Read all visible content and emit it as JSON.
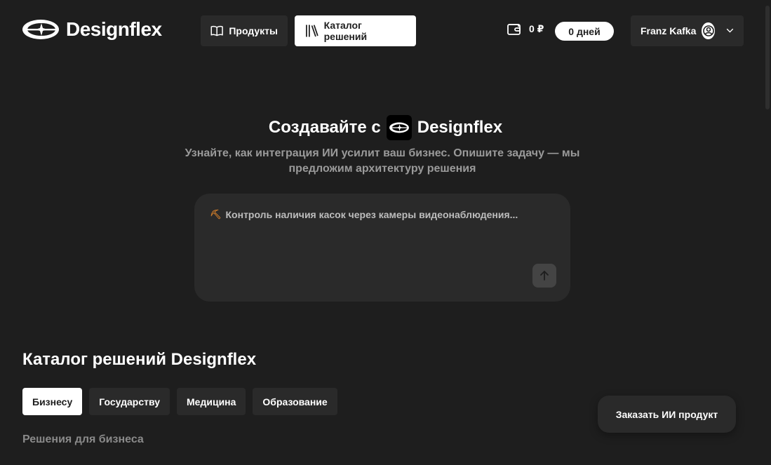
{
  "header": {
    "brand": "Designflex",
    "nav": {
      "products_label": "Продукты",
      "catalog_label": "Каталог решений"
    },
    "wallet_amount": "0 ₽",
    "days_label": "0 дней",
    "user_name": "Franz Kafka"
  },
  "hero": {
    "title_prefix": "Создавайте с",
    "title_brand": "Designflex",
    "subtitle": "Узнайте, как интеграция ИИ усилит ваш бизнес. Опишите задачу — мы предложим архитектуру решения",
    "prompt_emoji": "⛏",
    "prompt_placeholder": "Контроль наличия касок через камеры видеонаблюдения..."
  },
  "catalog": {
    "title": "Каталог решений Designflex",
    "tabs": [
      {
        "label": "Бизнесу",
        "active": true
      },
      {
        "label": "Государству",
        "active": false
      },
      {
        "label": "Медицина",
        "active": false
      },
      {
        "label": "Образование",
        "active": false
      }
    ],
    "section_label": "Решения для бизнеса"
  },
  "order_button_label": "Заказать ИИ продукт",
  "colors": {
    "background": "#1e1e1e",
    "surface": "#2a2a2a",
    "active": "#ffffff",
    "muted_text": "#9a9a9a"
  }
}
